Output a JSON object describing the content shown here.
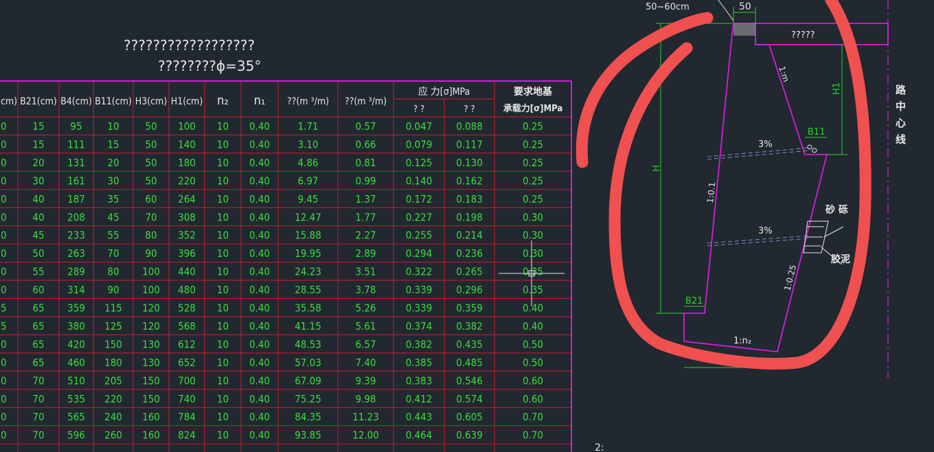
{
  "titles": {
    "line1": "??????????????????",
    "line2": "????????ϕ=35°"
  },
  "table": {
    "headers": [
      "cm)",
      "B21(cm)",
      "B4(cm)",
      "B11(cm)",
      "H3(cm)",
      "H1(cm)",
      "n₂",
      "n₁",
      "??(m ³/m)",
      "??(m ³/m)"
    ],
    "stress_header": "应 力[σ]MPa",
    "stress_sub": [
      "? ?",
      "? ?"
    ],
    "bearing_header_1": "要求地基",
    "bearing_header_2": "承载力[σ]MPa",
    "rows": [
      [
        "0",
        "15",
        "95",
        "10",
        "50",
        "100",
        "10",
        "0.40",
        "1.71",
        "0.57",
        "0.047",
        "0.088",
        "0.25"
      ],
      [
        "0",
        "15",
        "111",
        "15",
        "50",
        "140",
        "10",
        "0.40",
        "3.10",
        "0.66",
        "0.079",
        "0.117",
        "0.25"
      ],
      [
        "0",
        "20",
        "131",
        "20",
        "50",
        "180",
        "10",
        "0.40",
        "4.86",
        "0.81",
        "0.125",
        "0.130",
        "0.25"
      ],
      [
        "0",
        "30",
        "161",
        "30",
        "50",
        "220",
        "10",
        "0.40",
        "6.97",
        "0.99",
        "0.140",
        "0.162",
        "0.25"
      ],
      [
        "0",
        "40",
        "187",
        "35",
        "60",
        "264",
        "10",
        "0.40",
        "9.45",
        "1.37",
        "0.172",
        "0.183",
        "0.25"
      ],
      [
        "0",
        "40",
        "208",
        "45",
        "70",
        "308",
        "10",
        "0.40",
        "12.47",
        "1.77",
        "0.227",
        "0.198",
        "0.30"
      ],
      [
        "0",
        "45",
        "233",
        "55",
        "80",
        "352",
        "10",
        "0.40",
        "15.88",
        "2.27",
        "0.255",
        "0.214",
        "0.30"
      ],
      [
        "0",
        "50",
        "263",
        "70",
        "90",
        "396",
        "10",
        "0.40",
        "19.95",
        "2.89",
        "0.294",
        "0.236",
        "0.30"
      ],
      [
        "0",
        "55",
        "289",
        "80",
        "100",
        "440",
        "10",
        "0.40",
        "24.23",
        "3.51",
        "0.322",
        "0.265",
        "0.35"
      ],
      [
        "0",
        "60",
        "314",
        "90",
        "100",
        "480",
        "10",
        "0.40",
        "28.55",
        "3.78",
        "0.339",
        "0.296",
        "0.35"
      ],
      [
        "5",
        "65",
        "359",
        "115",
        "120",
        "528",
        "10",
        "0.40",
        "35.58",
        "5.26",
        "0.339",
        "0.359",
        "0.40"
      ],
      [
        "5",
        "65",
        "380",
        "125",
        "120",
        "568",
        "10",
        "0.40",
        "41.15",
        "5.61",
        "0.374",
        "0.382",
        "0.40"
      ],
      [
        "0",
        "65",
        "420",
        "150",
        "130",
        "612",
        "10",
        "0.40",
        "48.53",
        "6.57",
        "0.382",
        "0.435",
        "0.50"
      ],
      [
        "0",
        "65",
        "460",
        "180",
        "130",
        "652",
        "10",
        "0.40",
        "57.03",
        "7.40",
        "0.385",
        "0.485",
        "0.50"
      ],
      [
        "0",
        "70",
        "510",
        "205",
        "150",
        "700",
        "10",
        "0.40",
        "67.09",
        "9.39",
        "0.383",
        "0.546",
        "0.60"
      ],
      [
        "0",
        "70",
        "535",
        "220",
        "150",
        "740",
        "10",
        "0.40",
        "75.25",
        "9.98",
        "0.412",
        "0.574",
        "0.60"
      ],
      [
        "0",
        "70",
        "565",
        "240",
        "160",
        "784",
        "10",
        "0.40",
        "84.35",
        "11.23",
        "0.443",
        "0.605",
        "0.70"
      ],
      [
        "0",
        "70",
        "596",
        "260",
        "160",
        "824",
        "10",
        "0.40",
        "93.85",
        "12.00",
        "0.464",
        "0.639",
        "0.70"
      ]
    ]
  },
  "diagram": {
    "top_dim": "50",
    "top_left_dim": "50~60cm",
    "road_label": "?????",
    "center_line_label": [
      "路",
      "中",
      "心",
      "线"
    ],
    "h1_label": "H1",
    "h_label": "H",
    "b11_label": "B11",
    "b21_label": "B21",
    "slope_top": "1:m",
    "slope_front": "1:0.1",
    "slope_back": "1:0.25",
    "slope_base": "1:n₂",
    "drain_slope_1": "3%",
    "drain_slope_2": "3%",
    "gravel_label": "砂 砾",
    "clay_label": "胶泥",
    "bottom_mark": "2:"
  },
  "colors": {
    "background": "#212830",
    "grid": "#d11a2a",
    "frame": "#d21ed8",
    "value": "#3ddc3d",
    "text": "#e8e8e8",
    "dim": "#2fd12f",
    "annotation": "#ff4a4a"
  }
}
